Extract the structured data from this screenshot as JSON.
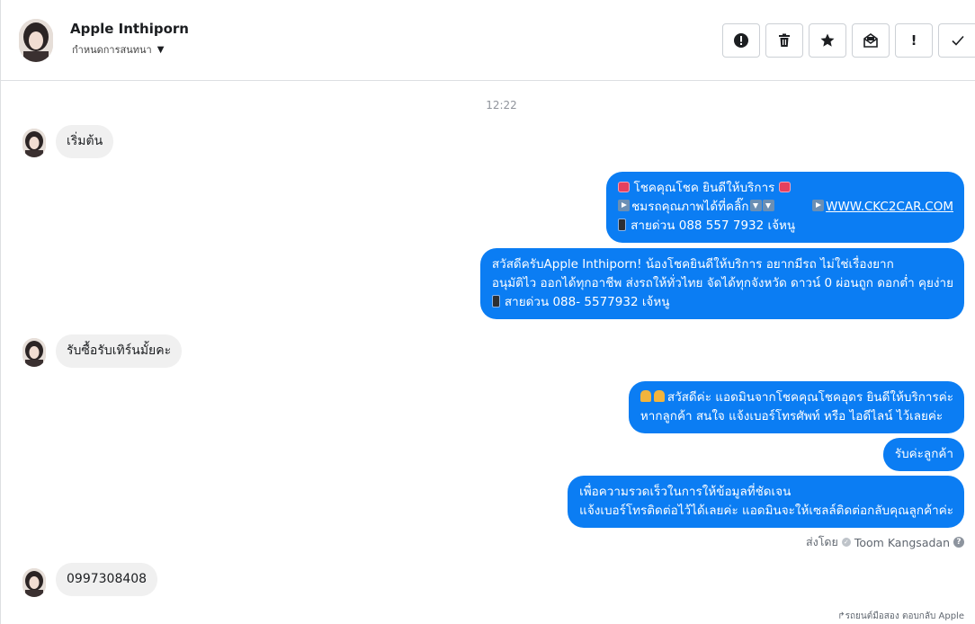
{
  "header": {
    "contact_name": "Apple Inthiporn",
    "contact_subtitle": "กำหนดการสนทนา",
    "toolbar": [
      {
        "name": "report-button",
        "icon": "alert-circle-icon"
      },
      {
        "name": "delete-button",
        "icon": "trash-icon"
      },
      {
        "name": "star-button",
        "icon": "star-icon"
      },
      {
        "name": "mark-unread-button",
        "icon": "envelope-icon"
      },
      {
        "name": "priority-button",
        "icon": "exclamation-icon",
        "label": "!"
      },
      {
        "name": "done-button",
        "icon": "check-icon"
      }
    ]
  },
  "thread": {
    "timestamp": "12:22",
    "incoming_1": "เริ่มต้น",
    "outgoing_1": {
      "line1": "โชคคุณโชค ยินดีให้บริการ",
      "line2_text": "ชมรถคุณภาพได้ที่คลิ๊ก",
      "line2_link": "WWW.CKC2CAR.COM",
      "line3": "สายด่วน 088 557 7932 เจ้หนู"
    },
    "outgoing_2": {
      "line1": "สวัสดีครับApple Inthiporn! น้องโชคยินดีให้บริการ อยากมีรถ ไม่ใช่เรื่องยาก",
      "line2": "อนุมัติไว ออกได้ทุกอาชีพ ส่งรถให้ทั่วไทย จัดได้ทุกจังหวัด ดาวน์ 0  ผ่อนถูก ดอกต่ำ คุยง่าย",
      "line3": "สายด่วน 088- 5577932 เจ้หนู"
    },
    "incoming_2": "รับซื้อรับเทิร์นมั้ยคะ",
    "outgoing_3": {
      "line1": "สวัสดีค่ะ แอดมินจากโชคคุณโชคอุดร ยินดีให้บริการค่ะ",
      "line2": "หากลูกค้า สนใจ แจ้งเบอร์โทรศัพท์ หรือ ไอดีไลน์  ไว้เลยค่ะ"
    },
    "outgoing_4": "รับค่ะลูกค้า",
    "outgoing_5": {
      "line1": "เพื่อความรวดเร็วในการให้ข้อมูลที่ชัดเจน",
      "line2": "แจ้งเบอร์โทรติดต่อไว้ได้เลยค่ะ แอดมินจะให้เซลล์ติดต่อกลับคุณลูกค้าค่ะ"
    },
    "sent_by_label": "ส่งโดย",
    "sent_by_name": "Toom Kangsadan",
    "incoming_3": "0997308408",
    "footer_note": "รถยนต์มือสอง ตอบกลับ Apple"
  },
  "colors": {
    "outgoing_bubble": "#0b7df3",
    "incoming_bubble": "#f0f0f0",
    "border": "#dddfe2"
  }
}
